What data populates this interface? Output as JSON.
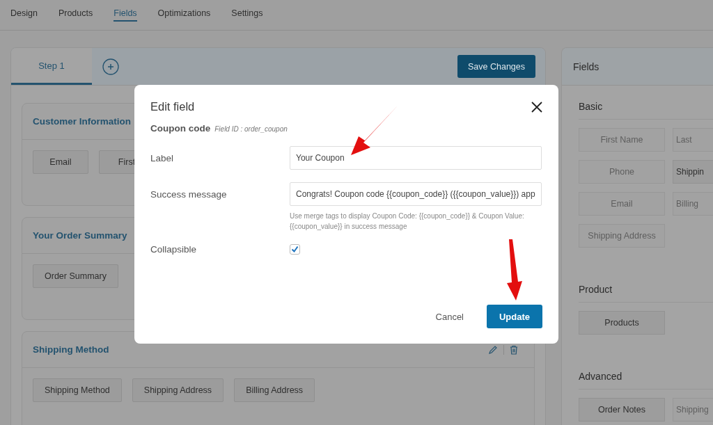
{
  "nav_tabs": [
    {
      "label": "Design",
      "selected": false
    },
    {
      "label": "Products",
      "selected": false
    },
    {
      "label": "Fields",
      "selected": true
    },
    {
      "label": "Optimizations",
      "selected": false
    },
    {
      "label": "Settings",
      "selected": false
    }
  ],
  "builder": {
    "steps": [
      {
        "label": "Step 1",
        "selected": true
      }
    ],
    "save_button": "Save Changes",
    "sections": [
      {
        "title": "Customer Information",
        "chips": [
          "Email",
          "First"
        ]
      },
      {
        "title": "Your Order Summary",
        "chips": [
          "Order Summary"
        ]
      },
      {
        "title": "Shipping Method",
        "actions_visible": true,
        "chips": [
          "Shipping Method",
          "Shipping Address",
          "Billing Address"
        ]
      }
    ]
  },
  "fields_panel": {
    "title": "Fields",
    "groups": [
      {
        "title": "Basic",
        "fields": [
          {
            "label": "First Name",
            "disabled": true
          },
          {
            "label": "Last",
            "disabled": true
          },
          {
            "label": "Phone",
            "disabled": true
          },
          {
            "label": "Shippin",
            "disabled": false
          },
          {
            "label": "Email",
            "disabled": true
          },
          {
            "label": "Billing",
            "disabled": true
          },
          {
            "label": "Shipping Address",
            "disabled": true
          }
        ]
      },
      {
        "title": "Product",
        "fields": [
          {
            "label": "Products",
            "disabled": false
          }
        ]
      },
      {
        "title": "Advanced",
        "fields": [
          {
            "label": "Order Notes",
            "disabled": false
          },
          {
            "label": "Shipping",
            "disabled": true
          }
        ]
      }
    ]
  },
  "modal": {
    "title": "Edit field",
    "field_name": "Coupon code",
    "field_id": "Field ID : order_coupon",
    "rows": [
      {
        "kind": "text",
        "label": "Label",
        "value": "Your Coupon"
      },
      {
        "kind": "text",
        "label": "Success message",
        "value": "Congrats! Coupon code {{coupon_code}} ({{coupon_value}}) app",
        "help": "Use merge tags to display Coupon Code: {{coupon_code}} & Coupon Value: {{coupon_value}} in success message"
      },
      {
        "kind": "checkbox",
        "label": "Collapsible",
        "checked": true
      }
    ],
    "cancel": "Cancel",
    "submit": "Update"
  }
}
